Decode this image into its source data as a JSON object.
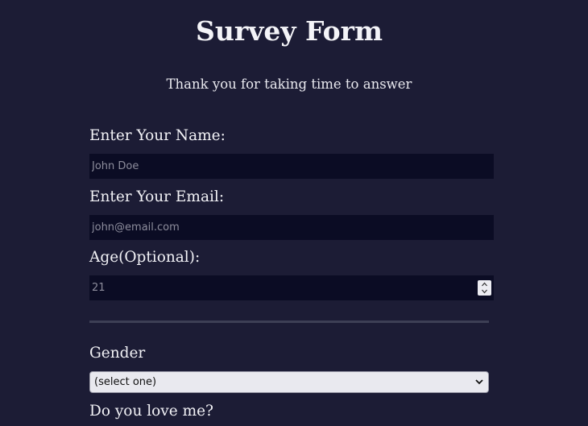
{
  "header": {
    "title": "Survey Form",
    "description": "Thank you for taking time to answer"
  },
  "form": {
    "name_label": "Enter Your Name:",
    "name_placeholder": "John Doe",
    "email_label": "Enter Your Email:",
    "email_placeholder": "john@email.com",
    "age_label": "Age(Optional):",
    "age_placeholder": "21",
    "gender_label": "Gender",
    "gender_selected": "(select one)",
    "love_label": "Do you love me?"
  },
  "icons": {
    "spinner_up": "chevron-up-icon",
    "spinner_down": "chevron-down-icon",
    "select_arrow": "chevron-down-icon"
  },
  "colors": {
    "background": "#1c1c35",
    "input_background": "#0b0c24",
    "divider": "#3d3f55",
    "text": "#f2f2f6"
  }
}
